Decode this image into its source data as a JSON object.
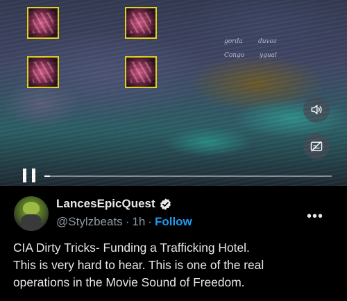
{
  "video": {
    "overlay_scribbles": [
      "gorda",
      "duvoz",
      "Congo",
      "ygual"
    ],
    "progress": 0.02,
    "controls": {
      "pause_icon": "pause-icon",
      "volume_icon": "speaker-icon",
      "captions_icon": "captions-off-icon"
    }
  },
  "post": {
    "author": {
      "display_name": "LancesEpicQuest",
      "handle": "@Stylzbeats",
      "verified": true
    },
    "time_separator": "·",
    "time": "1h",
    "follow_label": "Follow",
    "more_label": "•••",
    "text_lines": [
      "CIA Dirty Tricks- Funding a Trafficking Hotel.",
      "This is very hard to hear. This is one of the real",
      "operations in the Movie Sound of Freedom."
    ]
  },
  "colors": {
    "accent": "#1d9bf0",
    "text_primary": "#e7e9ea",
    "text_secondary": "#8b98a5",
    "background": "#000000"
  }
}
